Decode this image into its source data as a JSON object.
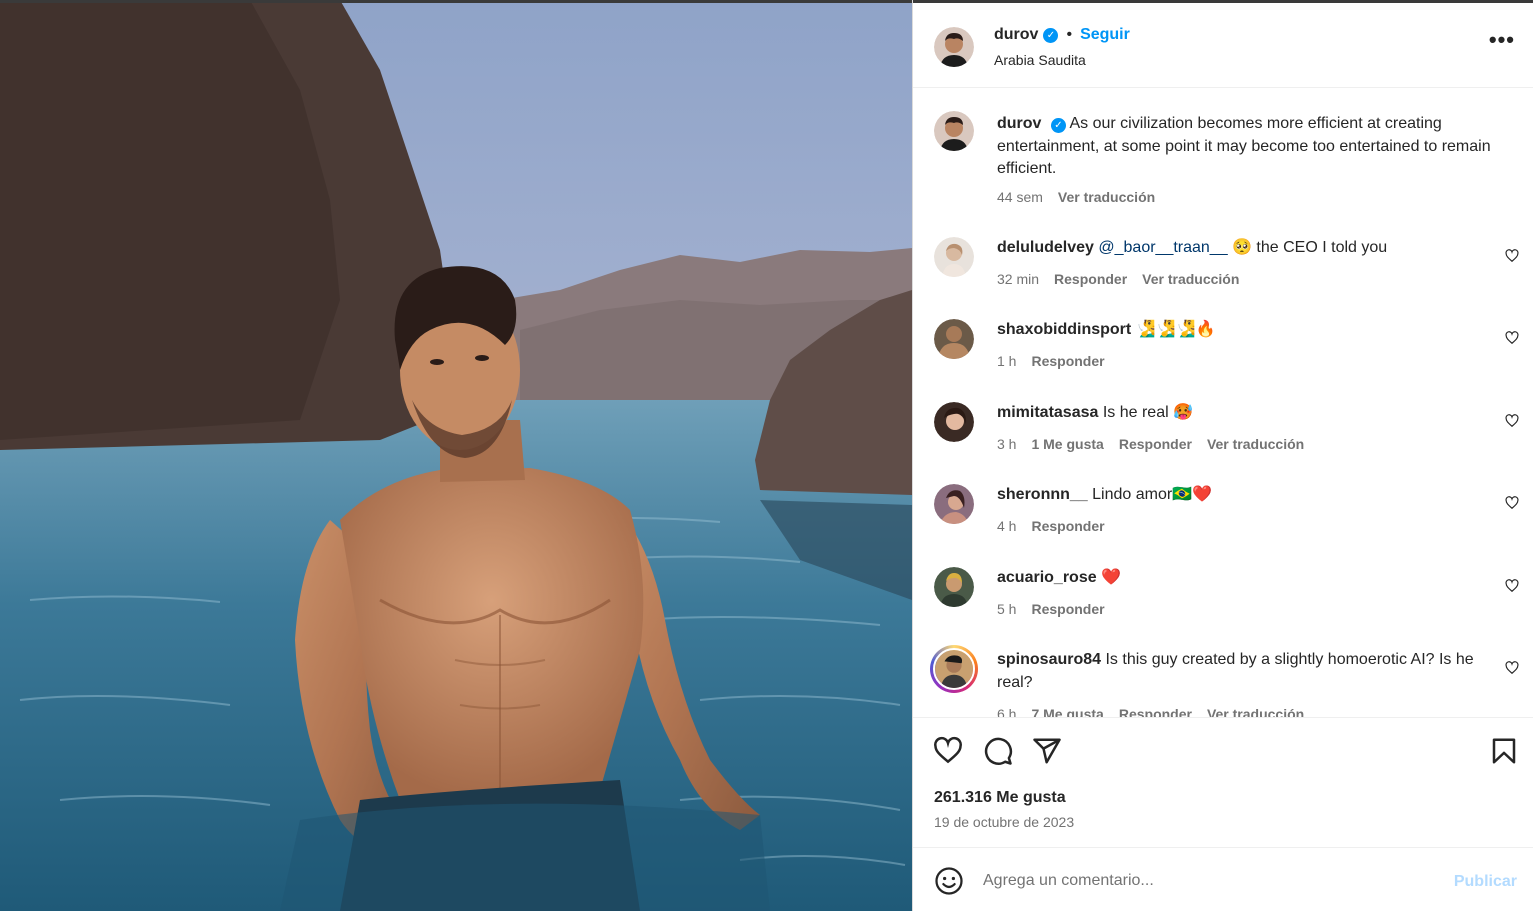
{
  "post": {
    "username": "durov",
    "verified_icon": "verified-badge-icon",
    "follow_label": "Seguir",
    "location": "Arabia Saudita",
    "more_icon": "more-options-icon"
  },
  "caption": {
    "username": "durov",
    "text": "As our civilization becomes more efficient at creating entertainment, at some point it may become too entertained to remain efficient.",
    "time": "44 sem",
    "translate": "Ver traducción"
  },
  "comments": [
    {
      "username": "deluludelvey",
      "mention": "@_baor__traan__",
      "text": " 🥺  the CEO I told you",
      "time": "32 min",
      "likes": "",
      "reply": "Responder",
      "translate": "Ver traducción"
    },
    {
      "username": "shaxobiddinsport",
      "mention": "",
      "text": " 🧏‍♂️🧏‍♂️🧏‍♂️🔥",
      "time": "1 h",
      "likes": "",
      "reply": "Responder",
      "translate": ""
    },
    {
      "username": "mimitatasasa",
      "mention": "",
      "text": " Is he real 🥵",
      "time": "3 h",
      "likes": "1 Me gusta",
      "reply": "Responder",
      "translate": "Ver traducción"
    },
    {
      "username": "sheronnn__",
      "mention": "",
      "text": " Lindo amor🇧🇷❤️",
      "time": "4 h",
      "likes": "",
      "reply": "Responder",
      "translate": ""
    },
    {
      "username": "acuario_rose",
      "mention": "",
      "text": " ❤️",
      "time": "5 h",
      "likes": "",
      "reply": "Responder",
      "translate": ""
    },
    {
      "username": "spinosauro84",
      "mention": "",
      "text": " Is this guy created by a slightly homoerotic AI? Is he real?",
      "time": "6 h",
      "likes": "7 Me gusta",
      "reply": "Responder",
      "translate": "Ver traducción"
    }
  ],
  "actions": {
    "like_icon": "heart-icon",
    "comment_icon": "comment-icon",
    "share_icon": "share-icon",
    "save_icon": "bookmark-icon",
    "likes": "261.316 Me gusta",
    "date": "19 de octubre de 2023"
  },
  "composer": {
    "emoji_icon": "emoji-icon",
    "placeholder": "Agrega un comentario...",
    "publish_label": "Publicar"
  },
  "colors": {
    "accent": "#0095f6",
    "text": "#262626",
    "muted": "#737373",
    "publish_disabled": "#b3dbff"
  }
}
